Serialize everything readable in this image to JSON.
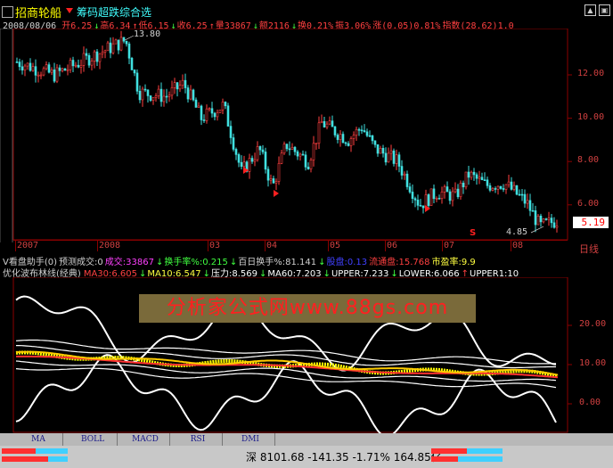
{
  "header": {
    "stock_name": "招商轮船",
    "indicator_name": "筹码超跌综合选"
  },
  "info_line": {
    "date": "2008/08/06",
    "items": [
      {
        "text": "开6.25",
        "color": "#ff4040"
      },
      {
        "text": "↓",
        "color": "#40ff40"
      },
      {
        "text": "高6.34",
        "color": "#ff4040"
      },
      {
        "text": "↑",
        "color": "#ff4040"
      },
      {
        "text": "低6.15",
        "color": "#ff4040"
      },
      {
        "text": "↓",
        "color": "#40ff40"
      },
      {
        "text": "收6.25",
        "color": "#ff4040"
      },
      {
        "text": "↑",
        "color": "#ff4040"
      },
      {
        "text": "量33867",
        "color": "#ff4040"
      },
      {
        "text": "↓",
        "color": "#40ff40"
      },
      {
        "text": "额2116",
        "color": "#ff4040"
      },
      {
        "text": "↓",
        "color": "#40ff40"
      },
      {
        "text": "换0.21%",
        "color": "#ff4040"
      },
      {
        "text": "振3.06%",
        "color": "#ff4040"
      },
      {
        "text": "涨(0.05)0.81%",
        "color": "#ff4040"
      },
      {
        "text": "指数(28.62)1.0",
        "color": "#ff4040"
      }
    ]
  },
  "price_panel": {
    "y_labels": [
      "12.00",
      "10.00",
      "8.00",
      "6.00"
    ],
    "high_label": "13.80",
    "low_label": "4.85",
    "current_price": "5.19",
    "signal_marker": "S",
    "period": "日线"
  },
  "time_axis": {
    "labels": [
      "2007",
      "2008",
      "03",
      "04",
      "05",
      "06",
      "07",
      "08"
    ]
  },
  "assistant_line": {
    "items": [
      {
        "text": "V看盘助手(0)",
        "color": "#d0d0d0"
      },
      {
        "text": "预测成交:0",
        "color": "#d0d0d0"
      },
      {
        "text": "成交:33867",
        "color": "#ff40ff"
      },
      {
        "text": "↓",
        "color": "#40ff40"
      },
      {
        "text": "换手率%:0.215",
        "color": "#40ff40"
      },
      {
        "text": "↓",
        "color": "#40ff40"
      },
      {
        "text": "百日换手%:81.141",
        "color": "#d0d0d0"
      },
      {
        "text": "↓",
        "color": "#40ff40"
      },
      {
        "text": "股盘:0.13",
        "color": "#4040ff"
      },
      {
        "text": "流通盘:15.768",
        "color": "#ff4040"
      },
      {
        "text": "市盈率:9.9",
        "color": "#ffff40"
      }
    ]
  },
  "indicator_line": {
    "name": "优化波布林线(经典)",
    "items": [
      {
        "text": "MA30:6.605",
        "color": "#ff4040"
      },
      {
        "text": "↓",
        "color": "#40ff40"
      },
      {
        "text": "MA10:6.547",
        "color": "#ffff40"
      },
      {
        "text": "↓",
        "color": "#40ff40"
      },
      {
        "text": "压力:8.569",
        "color": "#ffffff"
      },
      {
        "text": "↓",
        "color": "#40ff40"
      },
      {
        "text": "MA60:7.203",
        "color": "#ffffff"
      },
      {
        "text": "↓",
        "color": "#40ff40"
      },
      {
        "text": "UPPER:7.233",
        "color": "#ffffff"
      },
      {
        "text": "↓",
        "color": "#40ff40"
      },
      {
        "text": "LOWER:6.066",
        "color": "#ffffff"
      },
      {
        "text": "↑",
        "color": "#ff4040"
      },
      {
        "text": "UPPER1:10",
        "color": "#ffffff"
      }
    ]
  },
  "indicator_panel": {
    "y_labels": [
      "20.00",
      "10.00",
      "0.00"
    ]
  },
  "watermark": "分析家公式网www.88gs.com",
  "tabs": [
    "MA",
    "BOLL",
    "MACD",
    "RSI",
    "DMI"
  ],
  "status_bar": {
    "index_name": "深",
    "index_value": "8101.68",
    "change": "-141.35",
    "change_pct": "-1.71%",
    "amount": "164.85亿"
  },
  "colors": {
    "up": "#ff4040",
    "down": "#40e0e0",
    "grid": "#8b0000",
    "axis_text": "#d04040"
  }
}
